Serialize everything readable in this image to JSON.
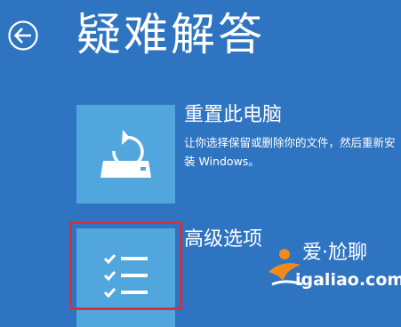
{
  "header": {
    "back_icon": "back-arrow-circle-icon",
    "title": "疑难解答"
  },
  "options": [
    {
      "icon": "reset-pc-icon",
      "title": "重置此电脑",
      "description": "让你选择保留或删除你的文件，然后重新安装 Windows。"
    },
    {
      "icon": "checklist-icon",
      "title": "高级选项"
    }
  ],
  "watermark": {
    "top": "爱·尬聊",
    "bottom": "igaliao.com"
  },
  "colors": {
    "background": "#2f74c1",
    "tile": "#52a6de",
    "highlight": "#d6303c",
    "watermark_orange": "#f08a1c"
  }
}
